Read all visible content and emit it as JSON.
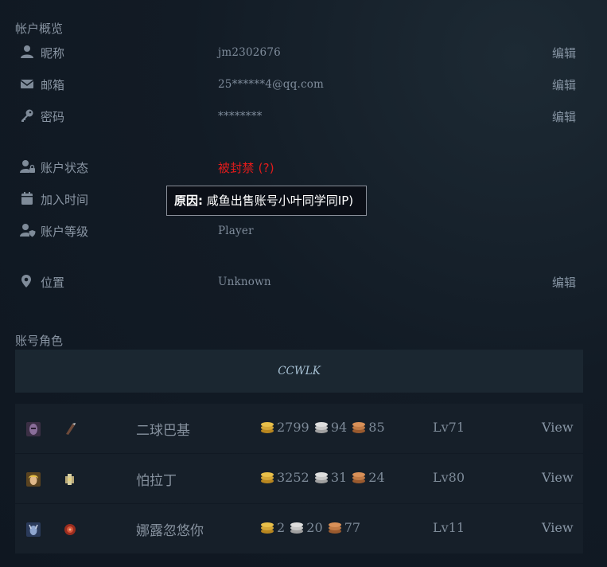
{
  "overview": {
    "title": "帐户概览",
    "rows": [
      {
        "label": "昵称",
        "value": "jm2302676",
        "edit": "编辑"
      },
      {
        "label": "邮箱",
        "value": "25******4@qq.com",
        "edit": "编辑"
      },
      {
        "label": "密码",
        "value": "********",
        "edit": "编辑"
      },
      {
        "label": "账户状态",
        "value": "被封禁 (?)"
      },
      {
        "label": "加入时间",
        "value": ""
      },
      {
        "label": "账户等级",
        "value": "Player"
      },
      {
        "label": "位置",
        "value": "Unknown",
        "edit": "编辑"
      }
    ],
    "tooltip": {
      "prefix": "原因:",
      "text": "咸鱼出售账号小叶同学同IP)"
    }
  },
  "characters": {
    "title": "账号角色",
    "realm": "CCWLK",
    "view_label": "View",
    "list": [
      {
        "name": "二球巴基",
        "gold": "2799",
        "silver": "94",
        "copper": "85",
        "level": "Lv71"
      },
      {
        "name": "怕拉丁",
        "gold": "3252",
        "silver": "31",
        "copper": "24",
        "level": "Lv80"
      },
      {
        "name": "娜露忽悠你",
        "gold": "2",
        "silver": "20",
        "copper": "77",
        "level": "Lv11"
      }
    ]
  },
  "colors": {
    "banned": "#e11b1b",
    "gold": "#d4a637",
    "silver": "#c7c7c7",
    "copper": "#c07a45"
  }
}
